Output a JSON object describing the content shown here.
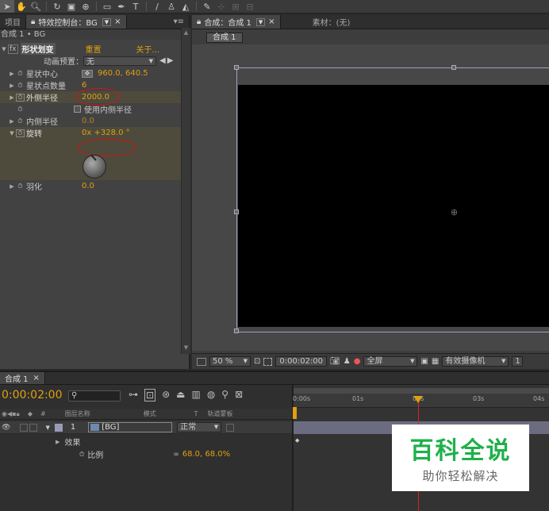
{
  "toolbar": {
    "icons": [
      "selection-tool-icon",
      "hand-tool-icon",
      "zoom-tool-icon",
      "rotate-tool-icon",
      "camera-tool-icon",
      "pan-behind-icon",
      "rectangle-tool-icon",
      "pen-tool-icon",
      "text-tool-icon",
      "brush-tool-icon",
      "clone-stamp-icon",
      "eraser-icon",
      "puppet-pin-icon"
    ],
    "T": "T"
  },
  "left_panel": {
    "tab_project": "项目",
    "tab_effect_controls": "特效控制台：BG",
    "subheader": "合成 1 • BG",
    "effect": {
      "fx": "fx",
      "name": "形状划变",
      "reset": "重置",
      "about": "关于...",
      "preset_label": "动画预置：",
      "preset_value": "无",
      "props": [
        {
          "label": "星状中心",
          "value": "960.0, 640.5"
        },
        {
          "label": "星状点数量",
          "value": "6"
        },
        {
          "label": "外侧半径",
          "value": "2000.0"
        },
        {
          "label": "使用内侧半径",
          "value": ""
        },
        {
          "label": "内侧半径",
          "value": "0.0"
        },
        {
          "label": "旋转",
          "value": "0x +328.0 °"
        },
        {
          "label": "羽化",
          "value": "0.0"
        }
      ]
    }
  },
  "comp_panel": {
    "tab_comp": "合成：合成 1",
    "tab_footage": "素材：(无)",
    "comp_button": "合成 1",
    "footer": {
      "zoom": "50 %",
      "timecode": "0:00:02:00",
      "resolution": "全屏",
      "camera": "有效摄像机",
      "views": "1"
    }
  },
  "timeline": {
    "tab": "合成 1",
    "timecode": "0:00:02:00",
    "col_source": "图层名称",
    "col_mode": "模式",
    "col_t": "T",
    "col_trkmat": "轨道蒙板",
    "col_num": "#",
    "layer_index": "1",
    "layer_name": "[BG]",
    "layer_mode": "正常",
    "effects_label": "效果",
    "scale_label": "比例",
    "scale_value": "68.0, 68.0%",
    "ruler": [
      "0:00s",
      "01s",
      "02s",
      "03s",
      "04s"
    ]
  },
  "watermark": {
    "title": "百科全说",
    "subtitle": "助你轻松解决"
  },
  "colors": {
    "accent_yellow": "#e0a010",
    "annotation_red": "#d11111",
    "watermark_green": "#1fb04a"
  }
}
